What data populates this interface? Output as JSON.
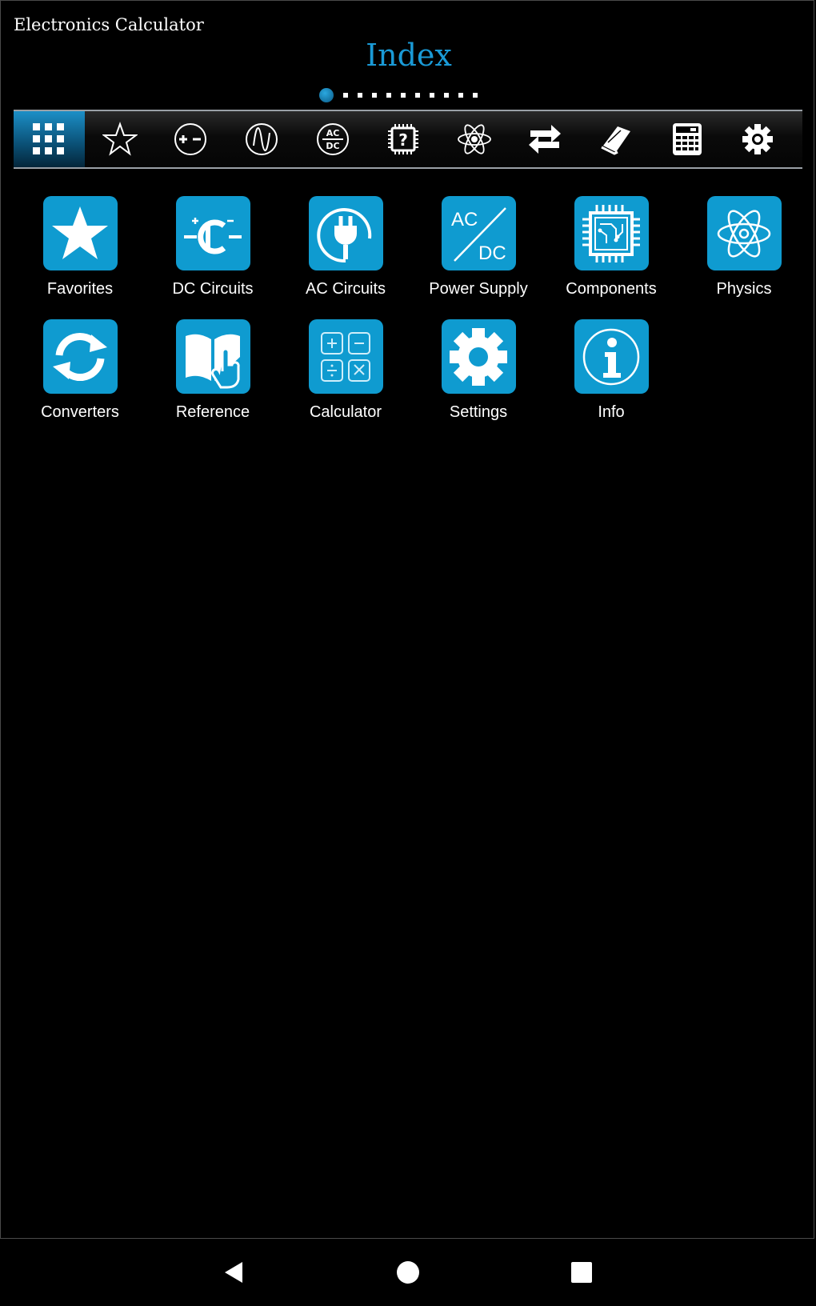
{
  "app": {
    "title": "Electronics Calculator"
  },
  "page": {
    "title": "Index",
    "pager_total": 12,
    "pager_active": 1
  },
  "colors": {
    "accent": "#1a9ad6",
    "tile": "#0f9bd0",
    "background": "#000000"
  },
  "tabs": [
    {
      "icon": "grid-icon",
      "active": true
    },
    {
      "icon": "star-outline-icon",
      "active": false
    },
    {
      "icon": "plus-minus-icon",
      "active": false
    },
    {
      "icon": "sine-wave-icon",
      "active": false
    },
    {
      "icon": "ac-dc-icon",
      "active": false
    },
    {
      "icon": "chip-question-icon",
      "active": false
    },
    {
      "icon": "atom-icon",
      "active": false
    },
    {
      "icon": "swap-arrows-icon",
      "active": false
    },
    {
      "icon": "book-icon",
      "active": false
    },
    {
      "icon": "calculator-icon",
      "active": false
    },
    {
      "icon": "gear-icon",
      "active": false
    }
  ],
  "items": [
    {
      "label": "Favorites",
      "icon": "star-icon"
    },
    {
      "label": "DC Circuits",
      "icon": "dc-circuit-icon"
    },
    {
      "label": "AC Circuits",
      "icon": "ac-plug-icon"
    },
    {
      "label": "Power Supply",
      "icon": "ac-dc-slash-icon",
      "ac": "AC",
      "dc": "DC"
    },
    {
      "label": "Components",
      "icon": "chip-icon"
    },
    {
      "label": "Physics",
      "icon": "atom-icon"
    },
    {
      "label": "Converters",
      "icon": "refresh-arrows-icon"
    },
    {
      "label": "Reference",
      "icon": "book-hand-icon"
    },
    {
      "label": "Calculator",
      "icon": "calculator-keys-icon"
    },
    {
      "label": "Settings",
      "icon": "gear-icon"
    },
    {
      "label": "Info",
      "icon": "info-icon"
    }
  ],
  "tab_icon_text": {
    "ac": "AC",
    "dc": "DC",
    "question": "?"
  },
  "navbar": [
    {
      "icon": "back-triangle-icon"
    },
    {
      "icon": "home-circle-icon"
    },
    {
      "icon": "recents-square-icon"
    }
  ]
}
